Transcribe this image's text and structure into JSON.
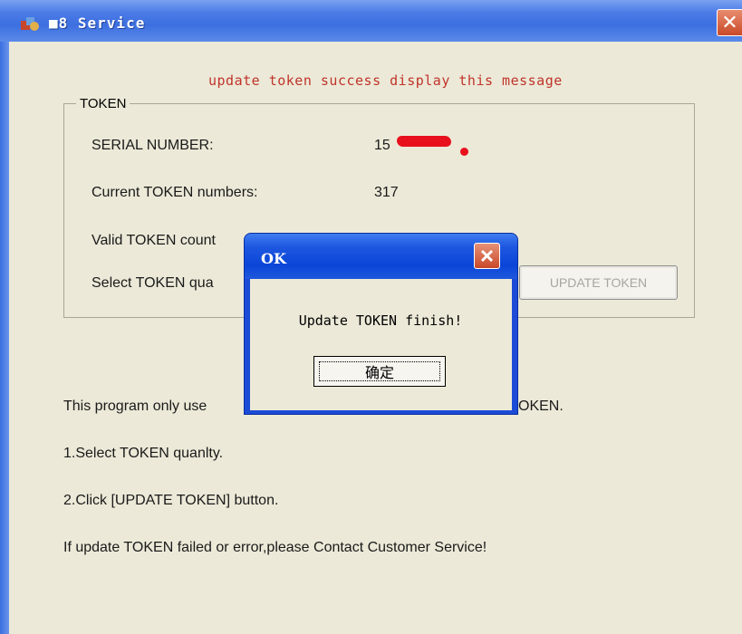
{
  "main_window": {
    "title": "■8 Service",
    "close_glyph": "✕"
  },
  "success_message": "update token success display this message",
  "token_group": {
    "label": "TOKEN",
    "serial_label": "SERIAL NUMBER:",
    "serial_value": "15",
    "current_label": "Current TOKEN numbers:",
    "current_value": "317",
    "valid_label": "Valid TOKEN count",
    "select_label": "Select TOKEN qua",
    "update_button_label": "UPDATE TOKEN"
  },
  "instructions": {
    "line1_left": "This program only use",
    "line1_right": "OKEN.",
    "line2": "1.Select TOKEN quanlty.",
    "line3": "2.Click [UPDATE TOKEN] button.",
    "line4": "If update TOKEN failed or error,please Contact Customer Service!"
  },
  "dialog": {
    "title": "OK",
    "message": "Update TOKEN finish!",
    "ok_button_label": "确定",
    "close_glyph": "✕"
  },
  "colors": {
    "titlebar_blue": "#3d6fe0",
    "message_red": "#c0342a",
    "window_bg": "#ece9d8"
  },
  "icons": [
    "app-icon",
    "close-icon"
  ]
}
